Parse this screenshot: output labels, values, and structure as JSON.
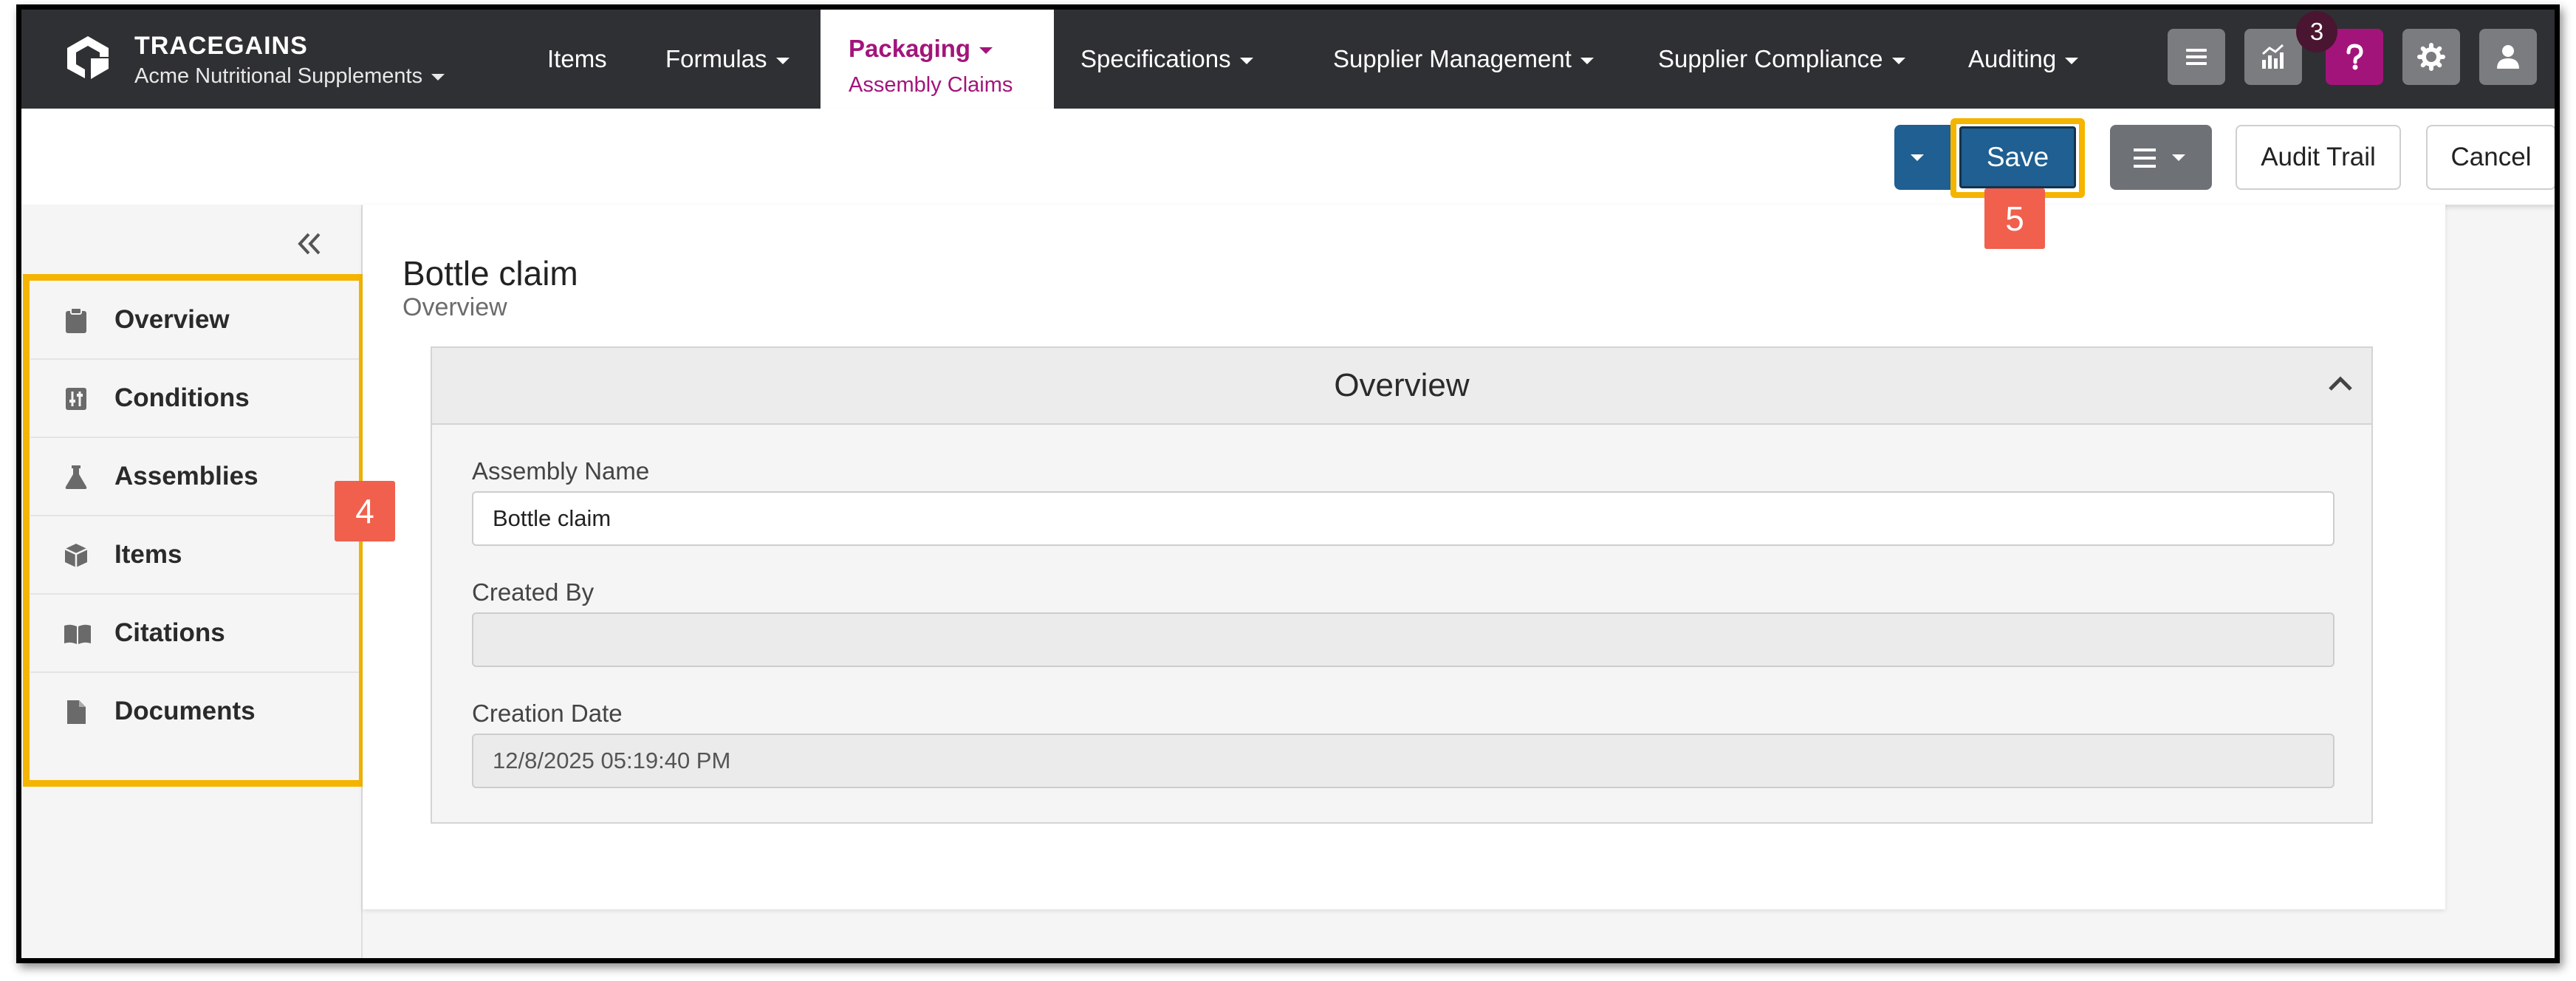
{
  "brand": {
    "name": "TRACEGAINS",
    "org": "Acme Nutritional Supplements"
  },
  "nav": {
    "items": "Items",
    "formulas": "Formulas",
    "packaging": "Packaging",
    "packaging_sub": "Assembly Claims",
    "specifications": "Specifications",
    "supplier_management": "Supplier Management",
    "supplier_compliance": "Supplier Compliance",
    "auditing": "Auditing",
    "notification_count": "3"
  },
  "toolbar": {
    "save_label": "Save",
    "audit_trail_label": "Audit Trail",
    "cancel_label": "Cancel"
  },
  "callouts": {
    "sidebar": "4",
    "save": "5"
  },
  "sidebar": {
    "items": [
      {
        "label": "Overview",
        "icon": "clipboard-icon"
      },
      {
        "label": "Conditions",
        "icon": "sliders-icon"
      },
      {
        "label": "Assemblies",
        "icon": "flask-icon"
      },
      {
        "label": "Items",
        "icon": "cube-icon"
      },
      {
        "label": "Citations",
        "icon": "book-icon"
      },
      {
        "label": "Documents",
        "icon": "file-icon"
      }
    ]
  },
  "record": {
    "title": "Bottle claim",
    "subtitle": "Overview"
  },
  "panel": {
    "title": "Overview",
    "fields": {
      "assembly_name_label": "Assembly Name",
      "assembly_name_value": "Bottle claim",
      "created_by_label": "Created By",
      "created_by_value": "",
      "creation_date_label": "Creation Date",
      "creation_date_value": "12/8/2025 05:19:40 PM"
    }
  },
  "colors": {
    "topnav": "#2f3033",
    "accent": "#a3147b",
    "primary": "#1f5f91",
    "highlight": "#f4b400",
    "callout": "#f0604d"
  }
}
